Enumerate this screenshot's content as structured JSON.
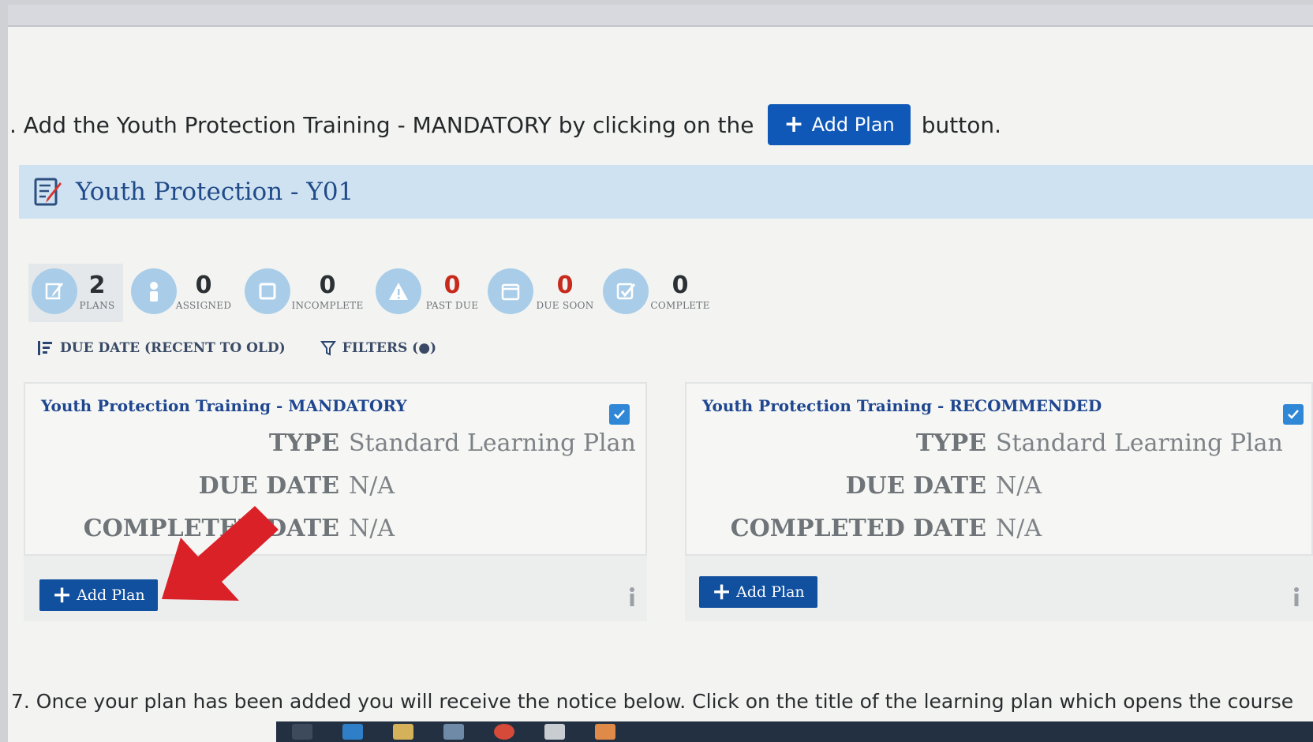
{
  "instruction": {
    "text_before": ". Add the Youth Protection Training - MANDATORY by clicking on the",
    "button_label": "Add Plan",
    "text_after": "button."
  },
  "header": {
    "title": "Youth Protection - Y01"
  },
  "stats": [
    {
      "icon": "pencil-icon",
      "value": "2",
      "label": "PLANS"
    },
    {
      "icon": "person-icon",
      "value": "0",
      "label": "ASSIGNED"
    },
    {
      "icon": "square-icon",
      "value": "0",
      "label": "INCOMPLETE"
    },
    {
      "icon": "warning-icon",
      "value": "0",
      "label": "PAST DUE",
      "color": "#c72a1d"
    },
    {
      "icon": "calendar-icon",
      "value": "0",
      "label": "DUE SOON",
      "color": "#c72a1d"
    },
    {
      "icon": "check-icon",
      "value": "0",
      "label": "COMPLETE"
    }
  ],
  "toolbar": {
    "sort_label": "DUE DATE (RECENT TO OLD)",
    "filters_label": "FILTERS (●)"
  },
  "cards": [
    {
      "title": "Youth Protection Training - MANDATORY",
      "type_label": "TYPE",
      "type_value": "Standard Learning Plan",
      "due_label": "DUE DATE",
      "due_value": "N/A",
      "completed_label": "COMPLETED DATE",
      "completed_value": "N/A",
      "button_label": "Add Plan"
    },
    {
      "title": "Youth Protection Training - RECOMMENDED",
      "type_label": "TYPE",
      "type_value": "Standard Learning Plan",
      "due_label": "DUE DATE",
      "due_value": "N/A",
      "completed_label": "COMPLETED DATE",
      "completed_value": "N/A",
      "button_label": "Add Plan"
    }
  ],
  "bottom_text": "7. Once your plan has been added you will receive the notice below. Click on the title of the learning plan which opens the course",
  "colors": {
    "primary_button": "#114f9f",
    "header_band": "#cfe2f2",
    "alert_red": "#c72a1d",
    "arrow_red": "#d92127"
  }
}
